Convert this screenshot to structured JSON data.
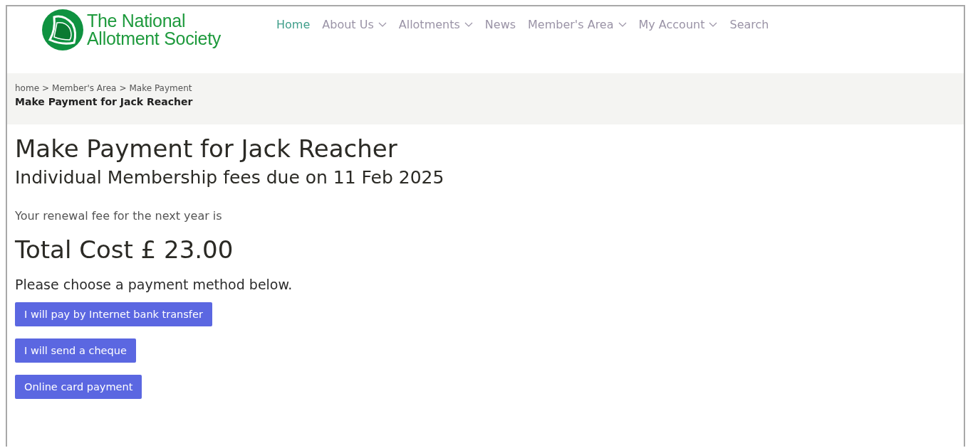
{
  "logo": {
    "line_1": "The National",
    "line_2": "Allotment Society"
  },
  "nav": [
    {
      "label": "Home",
      "selected": true,
      "dropdown": false
    },
    {
      "label": "About Us",
      "selected": false,
      "dropdown": true
    },
    {
      "label": "Allotments",
      "selected": false,
      "dropdown": true
    },
    {
      "label": "News",
      "selected": false,
      "dropdown": false
    },
    {
      "label": "Member's Area",
      "selected": false,
      "dropdown": true
    },
    {
      "label": "My Account",
      "selected": false,
      "dropdown": true
    },
    {
      "label": "Search",
      "selected": false,
      "dropdown": false
    }
  ],
  "breadcrumb": {
    "separator": ">",
    "trail": [
      "home",
      "Member's Area",
      "Make Payment"
    ],
    "current": "Make Payment for Jack Reacher"
  },
  "heading": "Make Payment for Jack Reacher",
  "subheading": "Individual Membership fees due on 11 Feb 2025",
  "intro": "Your renewal fee for the next year is",
  "total": "Total Cost £ 23.00",
  "prompt": "Please choose a payment method below.",
  "buttons": [
    "I will pay by Internet bank transfer",
    "I will send a cheque",
    "Online card payment"
  ]
}
